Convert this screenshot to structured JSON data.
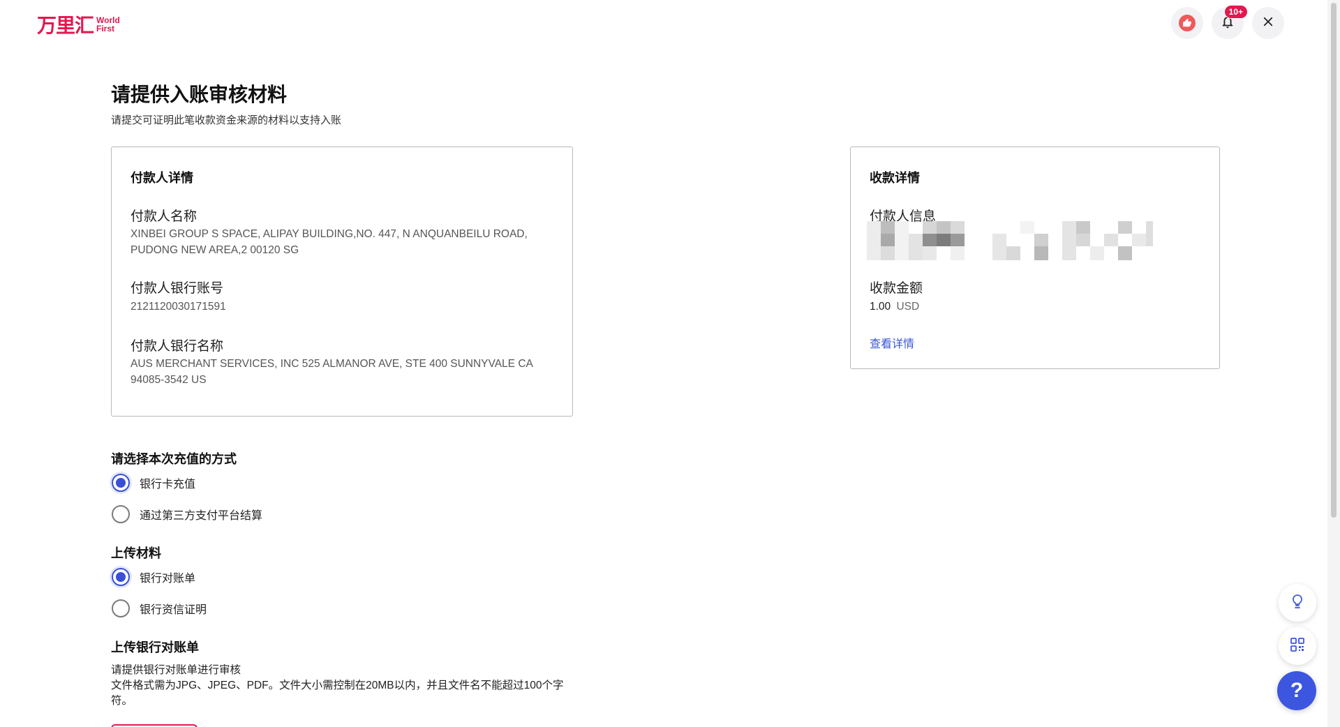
{
  "brand": {
    "name_cn": "万里汇",
    "name_en_1": "World",
    "name_en_2": "First"
  },
  "topbar": {
    "notification_count": "10+",
    "close_glyph": "×"
  },
  "header": {
    "title": "请提供入账审核材料",
    "subtitle": "请提交可证明此笔收款资金来源的材料以支持入账"
  },
  "payer_card": {
    "title": "付款人详情",
    "name_label": "付款人名称",
    "name_value_1": "XINBEI GROUP S SPACE, ALIPAY BUILDING,NO. 447, N ANQUANBEILU ROAD,",
    "name_value_2": "PUDONG NEW AREA,2 00120 SG",
    "account_label": "付款人银行账号",
    "account_value": "2121120030171591",
    "bank_label": "付款人银行名称",
    "bank_value_1": "AUS MERCHANT SERVICES, INC 525 ALMANOR AVE, STE 400 SUNNYVALE CA",
    "bank_value_2": "94085-3542 US"
  },
  "receipt_card": {
    "title": "收款详情",
    "payer_info_label": "付款人信息",
    "amount_label": "收款金额",
    "amount_value": "1.00",
    "amount_currency": "USD",
    "details_link": "查看详情"
  },
  "method_section": {
    "label": "请选择本次充值的方式",
    "options": [
      {
        "label": "银行卡充值",
        "checked": true
      },
      {
        "label": "通过第三方支付平台结算",
        "checked": false
      }
    ]
  },
  "material_section": {
    "label": "上传材料",
    "options": [
      {
        "label": "银行对账单",
        "checked": true
      },
      {
        "label": "银行资信证明",
        "checked": false
      }
    ]
  },
  "upload_section": {
    "label": "上传银行对账单",
    "desc_1": "请提供银行对账单进行审核",
    "desc_2": "文件格式需为JPG、JPEG、PDF。文件大小需控制在20MB以内，并且文件名不能超过100个字",
    "desc_3": "符。"
  },
  "floating": {
    "help_glyph": "?"
  },
  "colors": {
    "brand": "#e4174f",
    "accent": "#3a4fd6",
    "link": "#3a55d6"
  },
  "icons": [
    "thumbs-up-icon",
    "bell-icon",
    "close-icon",
    "lightbulb-icon",
    "qr-code-icon",
    "help-icon"
  ]
}
